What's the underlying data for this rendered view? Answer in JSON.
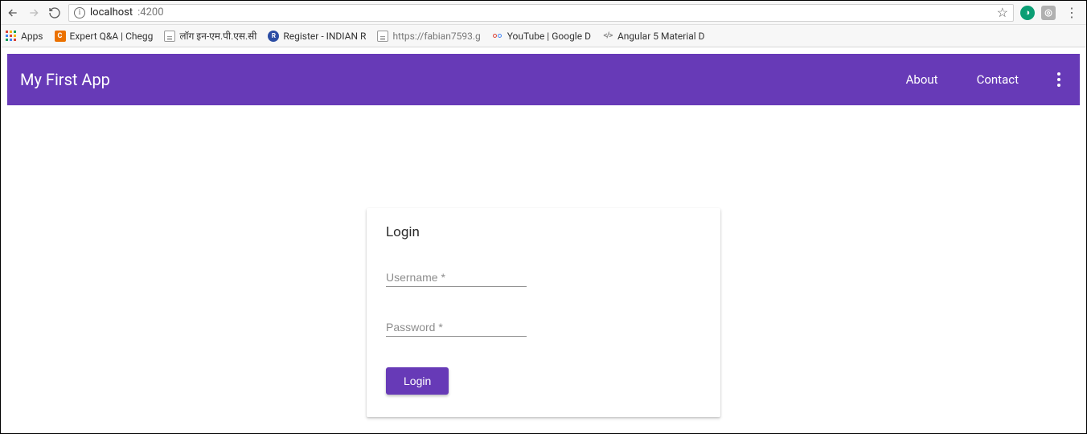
{
  "browser": {
    "url_host": "localhost",
    "url_port": ":4200",
    "bookmarks_label": "Apps",
    "bookmarks": [
      {
        "label": "Expert Q&A | Chegg"
      },
      {
        "label": "लॉग इन-एम.पी.एस.सी"
      },
      {
        "label": "Register - INDIAN R"
      },
      {
        "label": "https://fabian7593.g"
      },
      {
        "label": "YouTube  |  Google D"
      },
      {
        "label": "Angular 5 Material D"
      }
    ]
  },
  "app": {
    "title": "My First App",
    "nav": {
      "about": "About",
      "contact": "Contact"
    },
    "login": {
      "heading": "Login",
      "username_placeholder": "Username *",
      "password_placeholder": "Password *",
      "username_value": "",
      "password_value": "",
      "submit_label": "Login"
    }
  }
}
